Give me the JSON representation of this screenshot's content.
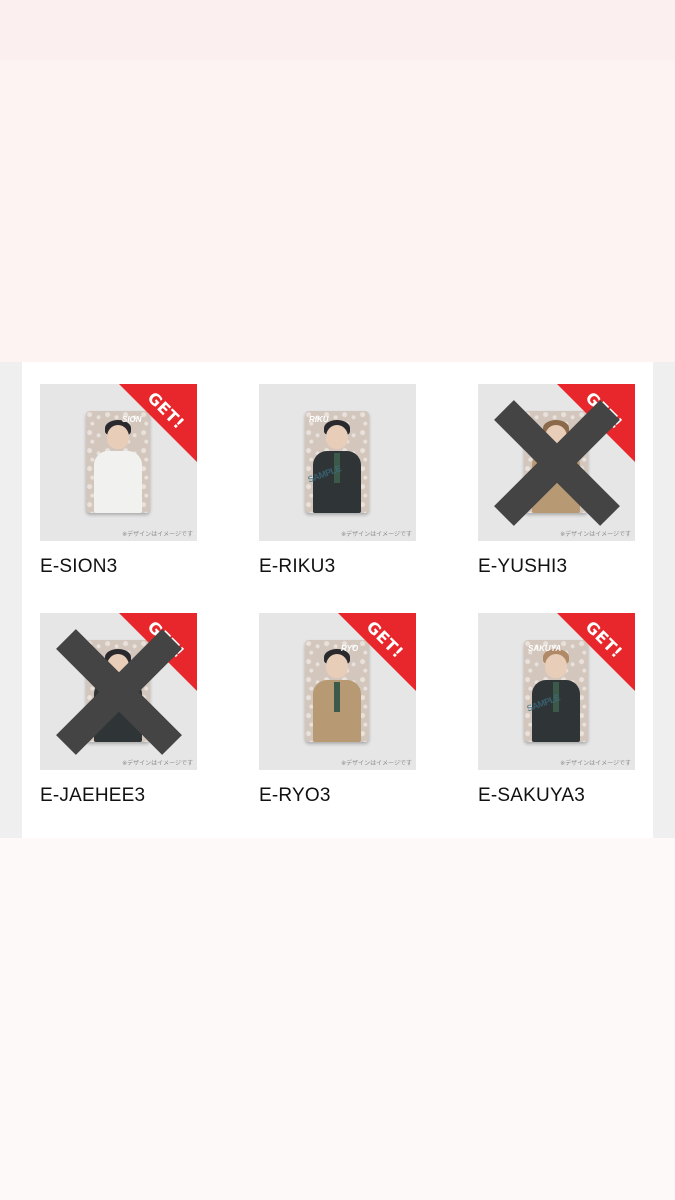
{
  "items": [
    {
      "name": "E-SION3",
      "badge": "GET!",
      "collected": true,
      "crossed": false,
      "caption": "※デザインはイメージです",
      "sign": "SION"
    },
    {
      "name": "E-RIKU3",
      "badge": "",
      "collected": false,
      "crossed": false,
      "caption": "※デザインはイメージです",
      "sign": "RIKU"
    },
    {
      "name": "E-YUSHI3",
      "badge": "GET!",
      "collected": true,
      "crossed": true,
      "caption": "※デザインはイメージです",
      "sign": ""
    },
    {
      "name": "E-JAEHEE3",
      "badge": "GET!",
      "collected": true,
      "crossed": true,
      "caption": "※デザインはイメージです",
      "sign": ""
    },
    {
      "name": "E-RYO3",
      "badge": "GET!",
      "collected": true,
      "crossed": false,
      "caption": "※デザインはイメージです",
      "sign": "RYO"
    },
    {
      "name": "E-SAKUYA3",
      "badge": "GET!",
      "collected": true,
      "crossed": false,
      "caption": "※デザインはイメージです",
      "sign": "SAKUYA"
    }
  ],
  "sample_watermark": "SAMPLE",
  "colors": {
    "badge": "#e8272c",
    "cross": "#444444",
    "thumb_bg": "#e6e6e6"
  }
}
